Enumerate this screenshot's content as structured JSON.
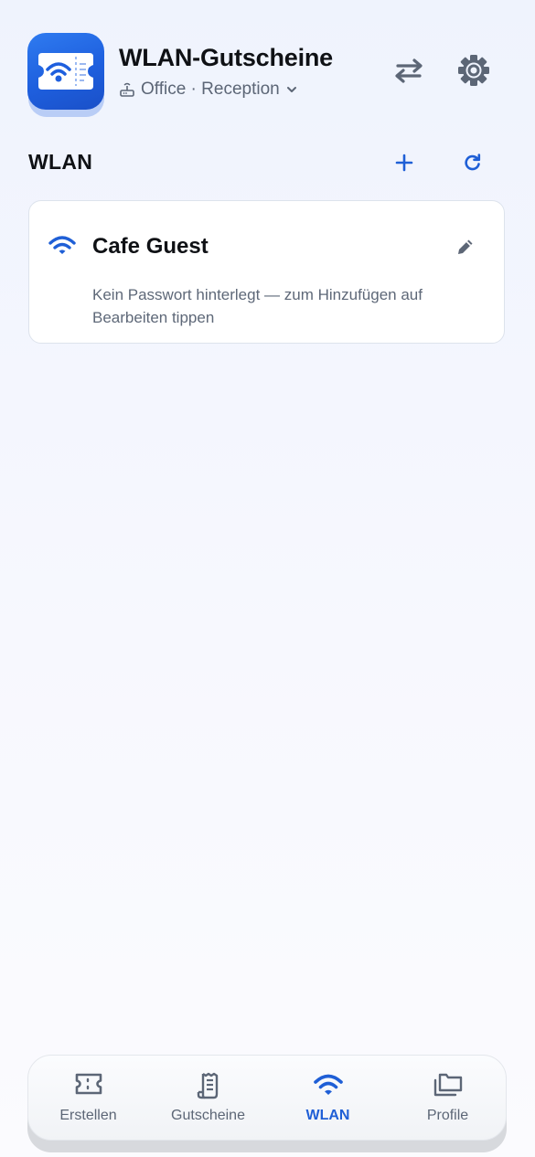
{
  "header": {
    "app_title": "WLAN-Gutscheine",
    "profile_selector": "Office · Reception",
    "icons": [
      "router-icon",
      "chevron-down-icon",
      "swap-arrows-icon",
      "gear-icon"
    ]
  },
  "section": {
    "title": "WLAN",
    "icons": [
      "plus-icon",
      "refresh-icon"
    ]
  },
  "networks": [
    {
      "ssid": "Cafe Guest",
      "message": "Kein Passwort hinterlegt — zum Hinzufügen auf Bearbeiten tippen",
      "icons": [
        "wifi-icon",
        "pencil-icon"
      ]
    }
  ],
  "bottom_nav": {
    "items": [
      {
        "label": "Erstellen",
        "icon": "ticket-icon",
        "active": false
      },
      {
        "label": "Gutscheine",
        "icon": "receipt-icon",
        "active": false
      },
      {
        "label": "WLAN",
        "icon": "wifi-icon",
        "active": true
      },
      {
        "label": "Profile",
        "icon": "folders-icon",
        "active": false
      }
    ]
  },
  "colors": {
    "accent": "#1f5fd6",
    "icon_gray": "#5c6676",
    "app_icon_blue": "#2469e6"
  }
}
